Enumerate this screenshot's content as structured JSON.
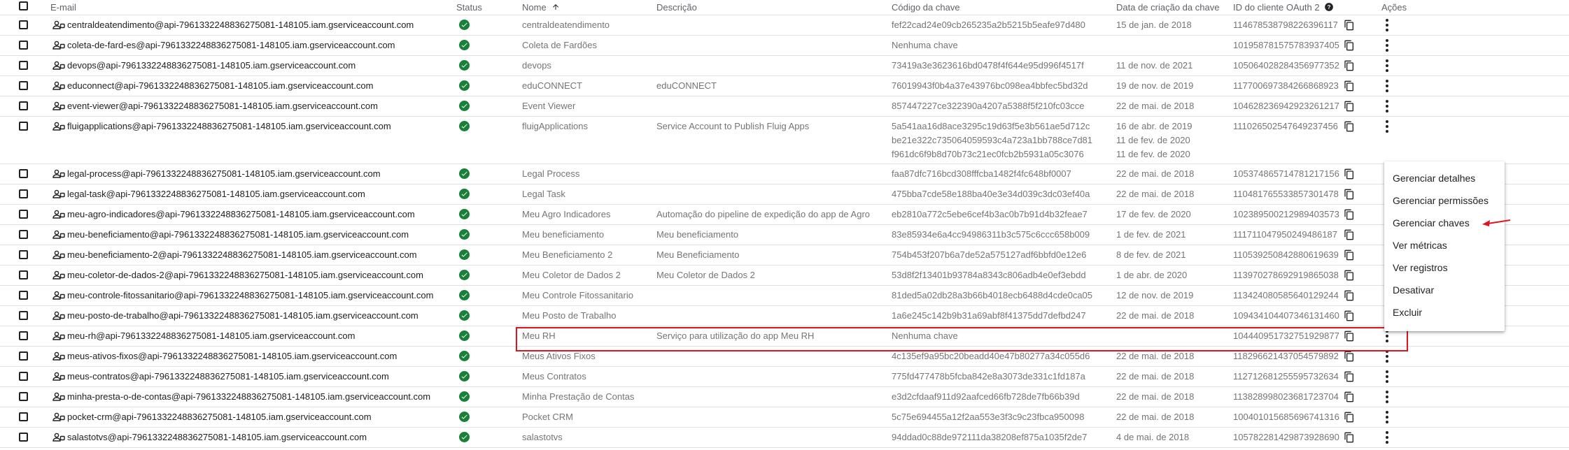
{
  "columns": {
    "email": "E-mail",
    "status": "Status",
    "nome": "Nome",
    "descricao": "Descrição",
    "codigo": "Código da chave",
    "data": "Data de criação da chave",
    "oauth": "ID do cliente OAuth 2",
    "acoes": "Ações"
  },
  "rows": [
    {
      "email": "centraldeatendimento@api-7961332248836275081-148105.iam.gserviceaccount.com",
      "nome": "centraldeatendimento",
      "descricao": "",
      "codigo": [
        "fef22cad24e09cb265235a2b5215b5eafe97d480"
      ],
      "data": [
        "15 de jan. de 2018"
      ],
      "oauth": "114678538798226396117"
    },
    {
      "email": "coleta-de-fard-es@api-7961332248836275081-148105.iam.gserviceaccount.com",
      "nome": "Coleta de Fardões",
      "descricao": "",
      "codigo": [
        "Nenhuma chave"
      ],
      "data": [],
      "oauth": "101958781575783937405"
    },
    {
      "email": "devops@api-7961332248836275081-148105.iam.gserviceaccount.com",
      "nome": "devops",
      "descricao": "",
      "codigo": [
        "73419a3e3623616bd0478f4f644e95d996f4517f"
      ],
      "data": [
        "11 de nov. de 2021"
      ],
      "oauth": "105064028284356977352"
    },
    {
      "email": "educonnect@api-7961332248836275081-148105.iam.gserviceaccount.com",
      "nome": "eduCONNECT",
      "descricao": "eduCONNECT",
      "codigo": [
        "76019943f0b4a37e43976bc098ea4bbfec5bd32d"
      ],
      "data": [
        "19 de nov. de 2019"
      ],
      "oauth": "117700697384266868923"
    },
    {
      "email": "event-viewer@api-7961332248836275081-148105.iam.gserviceaccount.com",
      "nome": "Event Viewer",
      "descricao": "",
      "codigo": [
        "857447227ce322390a4207a5388f5f210fc03cce"
      ],
      "data": [
        "22 de mai. de 2018"
      ],
      "oauth": "104628236942923261217"
    },
    {
      "email": "fluigapplications@api-7961332248836275081-148105.iam.gserviceaccount.com",
      "nome": "fluigApplications",
      "descricao": "Service Account to Publish Fluig Apps",
      "codigo": [
        "5a541aa16d8ace3295c19d63f5e3b561ae5d712c",
        "be21e322c735064059593c4a723a1bb788ce7d81",
        "f961dc6f9b8d70b73c21ec0fcb2b5931a05c3076"
      ],
      "data": [
        "16 de abr. de 2019",
        "11 de fev. de 2020",
        "11 de fev. de 2020"
      ],
      "oauth": "111026502547649237456"
    },
    {
      "email": "legal-process@api-7961332248836275081-148105.iam.gserviceaccount.com",
      "nome": "Legal Process",
      "descricao": "",
      "codigo": [
        "faa87dfc716bcd308fffcba1482f4fc648bf0007"
      ],
      "data": [
        "22 de mai. de 2018"
      ],
      "oauth": "105374865714781217156"
    },
    {
      "email": "legal-task@api-7961332248836275081-148105.iam.gserviceaccount.com",
      "nome": "Legal Task",
      "descricao": "",
      "codigo": [
        "475bba7cde58e188ba40e3e34d039c3dc03ef40a"
      ],
      "data": [
        "22 de mai. de 2018"
      ],
      "oauth": "110481765533857301478"
    },
    {
      "email": "meu-agro-indicadores@api-7961332248836275081-148105.iam.gserviceaccount.com",
      "nome": "Meu Agro Indicadores",
      "descricao": "Automação do pipeline de expedição do app de Agro",
      "codigo": [
        "eb2810a772c5ebe6cef4b3ac0b7b91d4b32feae7"
      ],
      "data": [
        "17 de fev. de 2020"
      ],
      "oauth": "102389500212989403573"
    },
    {
      "email": "meu-beneficiamento@api-7961332248836275081-148105.iam.gserviceaccount.com",
      "nome": "Meu beneficiamento",
      "descricao": "Meu beneficiamento",
      "codigo": [
        "83e85934e6a4cc94986311b3c575c6ccc658b009"
      ],
      "data": [
        "1 de fev. de 2021"
      ],
      "oauth": "111711047950249486187"
    },
    {
      "email": "meu-beneficiamento-2@api-7961332248836275081-148105.iam.gserviceaccount.com",
      "nome": "Meu Beneficiamento 2",
      "descricao": "Meu Beneficiamento",
      "codigo": [
        "754b453f207b6a7de52a575127adf6bbfd0e12e6"
      ],
      "data": [
        "8 de fev. de 2021"
      ],
      "oauth": "110539250842880619639"
    },
    {
      "email": "meu-coletor-de-dados-2@api-7961332248836275081-148105.iam.gserviceaccount.com",
      "nome": "Meu Coletor de Dados 2",
      "descricao": "Meu Coletor de Dados 2",
      "codigo": [
        "53d8f2f13401b93784a8343c806adb4e0ef3ebdd"
      ],
      "data": [
        "1 de abr. de 2020"
      ],
      "oauth": "113970278692919865038"
    },
    {
      "email": "meu-controle-fitossanitario@api-7961332248836275081-148105.iam.gserviceaccount.com",
      "nome": "Meu Controle Fitossanitario",
      "descricao": "",
      "codigo": [
        "81ded5a02db28a3b66b4018ecb6488d4cde0ca05"
      ],
      "data": [
        "12 de nov. de 2019"
      ],
      "oauth": "113424080585640129244"
    },
    {
      "email": "meu-posto-de-trabalho@api-7961332248836275081-148105.iam.gserviceaccount.com",
      "nome": "Meu Posto de Trabalho",
      "descricao": "",
      "codigo": [
        "1a6e245c142b9b31a69abf8f41375dd7defbd247"
      ],
      "data": [
        "22 de mai. de 2018"
      ],
      "oauth": "109434104407346131460"
    },
    {
      "email": "meu-rh@api-7961332248836275081-148105.iam.gserviceaccount.com",
      "nome": "Meu RH",
      "descricao": "Serviço para utilização do app Meu RH",
      "codigo": [
        "Nenhuma chave"
      ],
      "data": [],
      "oauth": "104440951732751929877"
    },
    {
      "email": "meus-ativos-fixos@api-7961332248836275081-148105.iam.gserviceaccount.com",
      "nome": "Meus Ativos Fixos",
      "descricao": "",
      "codigo": [
        "4c135ef9a95bc20beadd40e47b80277a34c055d6"
      ],
      "data": [
        "22 de mai. de 2018"
      ],
      "oauth": "118296621437054579892"
    },
    {
      "email": "meus-contratos@api-7961332248836275081-148105.iam.gserviceaccount.com",
      "nome": "Meus Contratos",
      "descricao": "",
      "codigo": [
        "775fd477478b5fcba842e8a3073de331c1fd187a"
      ],
      "data": [
        "22 de mai. de 2018"
      ],
      "oauth": "112712681255595732634"
    },
    {
      "email": "minha-presta-o-de-contas@api-7961332248836275081-148105.iam.gserviceaccount.com",
      "nome": "Minha Prestação de Contas",
      "descricao": "",
      "codigo": [
        "e3d2cfdaaf911d92aafced66fb728de7fb66b39d"
      ],
      "data": [
        "22 de mai. de 2018"
      ],
      "oauth": "113828998023681723704"
    },
    {
      "email": "pocket-crm@api-7961332248836275081-148105.iam.gserviceaccount.com",
      "nome": "Pocket CRM",
      "descricao": "",
      "codigo": [
        "5c75e694455a12f2aa553e3f3c9c23fbca950098"
      ],
      "data": [
        "22 de mai. de 2018"
      ],
      "oauth": "100401015685696741316"
    },
    {
      "email": "salastotvs@api-7961332248836275081-148105.iam.gserviceaccount.com",
      "nome": "salastotvs",
      "descricao": "",
      "codigo": [
        "94ddad0c88de972111da38208ef875a1035f2de7"
      ],
      "data": [
        "4 de mai. de 2018"
      ],
      "oauth": "105782281429873928690"
    }
  ],
  "menu": {
    "items": [
      "Gerenciar detalhes",
      "Gerenciar permissões",
      "Gerenciar chaves",
      "Ver métricas",
      "Ver registros",
      "Desativar",
      "Excluir"
    ]
  },
  "colors": {
    "status_ok": "#188038",
    "highlight": "#e0141e"
  },
  "icons": {
    "status": "check-circle-icon",
    "email": "service-account-icon",
    "oauth": "copy-icon",
    "acoes": "more-vert-icon",
    "nome_sort": "arrow-upward-icon",
    "oauth_help": "help-icon"
  }
}
